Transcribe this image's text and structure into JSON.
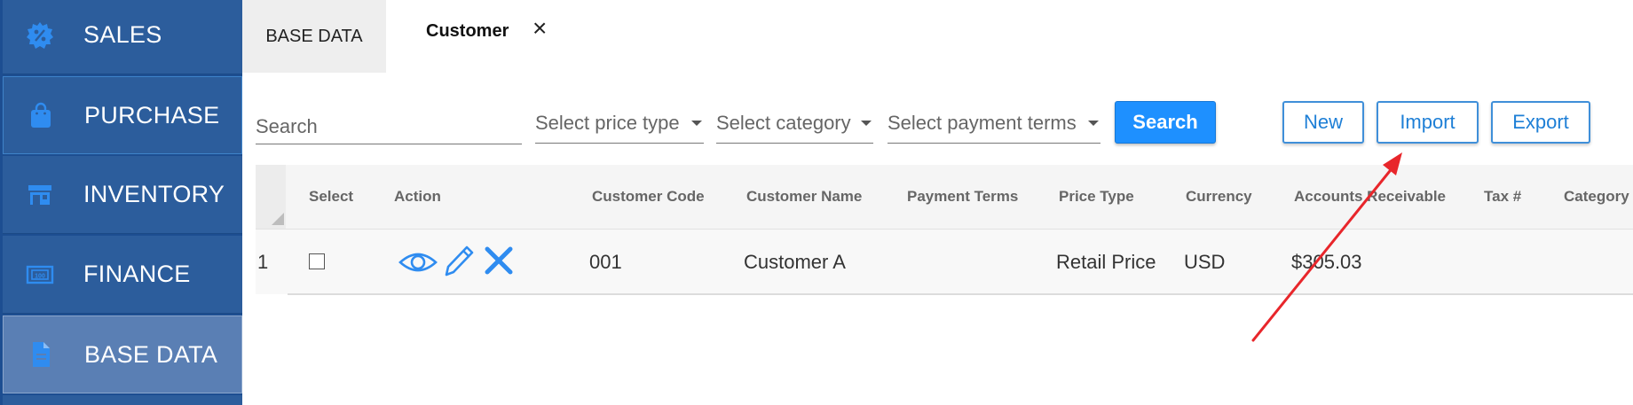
{
  "sidebar": {
    "items": [
      {
        "label": "SALES",
        "icon": "percent-badge-icon"
      },
      {
        "label": "PURCHASE",
        "icon": "shopping-bag-icon"
      },
      {
        "label": "INVENTORY",
        "icon": "store-icon"
      },
      {
        "label": "FINANCE",
        "icon": "money-icon"
      },
      {
        "label": "BASE DATA",
        "icon": "document-icon",
        "active": true
      }
    ]
  },
  "tabs": [
    {
      "label": "BASE DATA"
    },
    {
      "label": "Customer",
      "active": true,
      "close": "×"
    }
  ],
  "filters": {
    "search_placeholder": "Search",
    "price_type": "Select price type",
    "category": "Select category",
    "payment_terms": "Select payment terms"
  },
  "buttons": {
    "search": "Search",
    "new": "New",
    "import": "Import",
    "export": "Export"
  },
  "table": {
    "columns": [
      "Select",
      "Action",
      "Customer Code",
      "Customer Name",
      "Payment Terms",
      "Price Type",
      "Currency",
      "Accounts Receivable",
      "Tax #",
      "Category"
    ],
    "rows": [
      {
        "row_num": "1",
        "code": "001",
        "name": "Customer A",
        "payment_terms": "",
        "price_type": "Retail Price",
        "currency": "USD",
        "accounts_receivable": "$305.03",
        "tax": "",
        "category": ""
      }
    ]
  },
  "colors": {
    "sidebar": "#2c5d9c",
    "sidebar_active": "#5a7fb4",
    "primary": "#1e90ff",
    "annotation_arrow": "#e8262b"
  }
}
